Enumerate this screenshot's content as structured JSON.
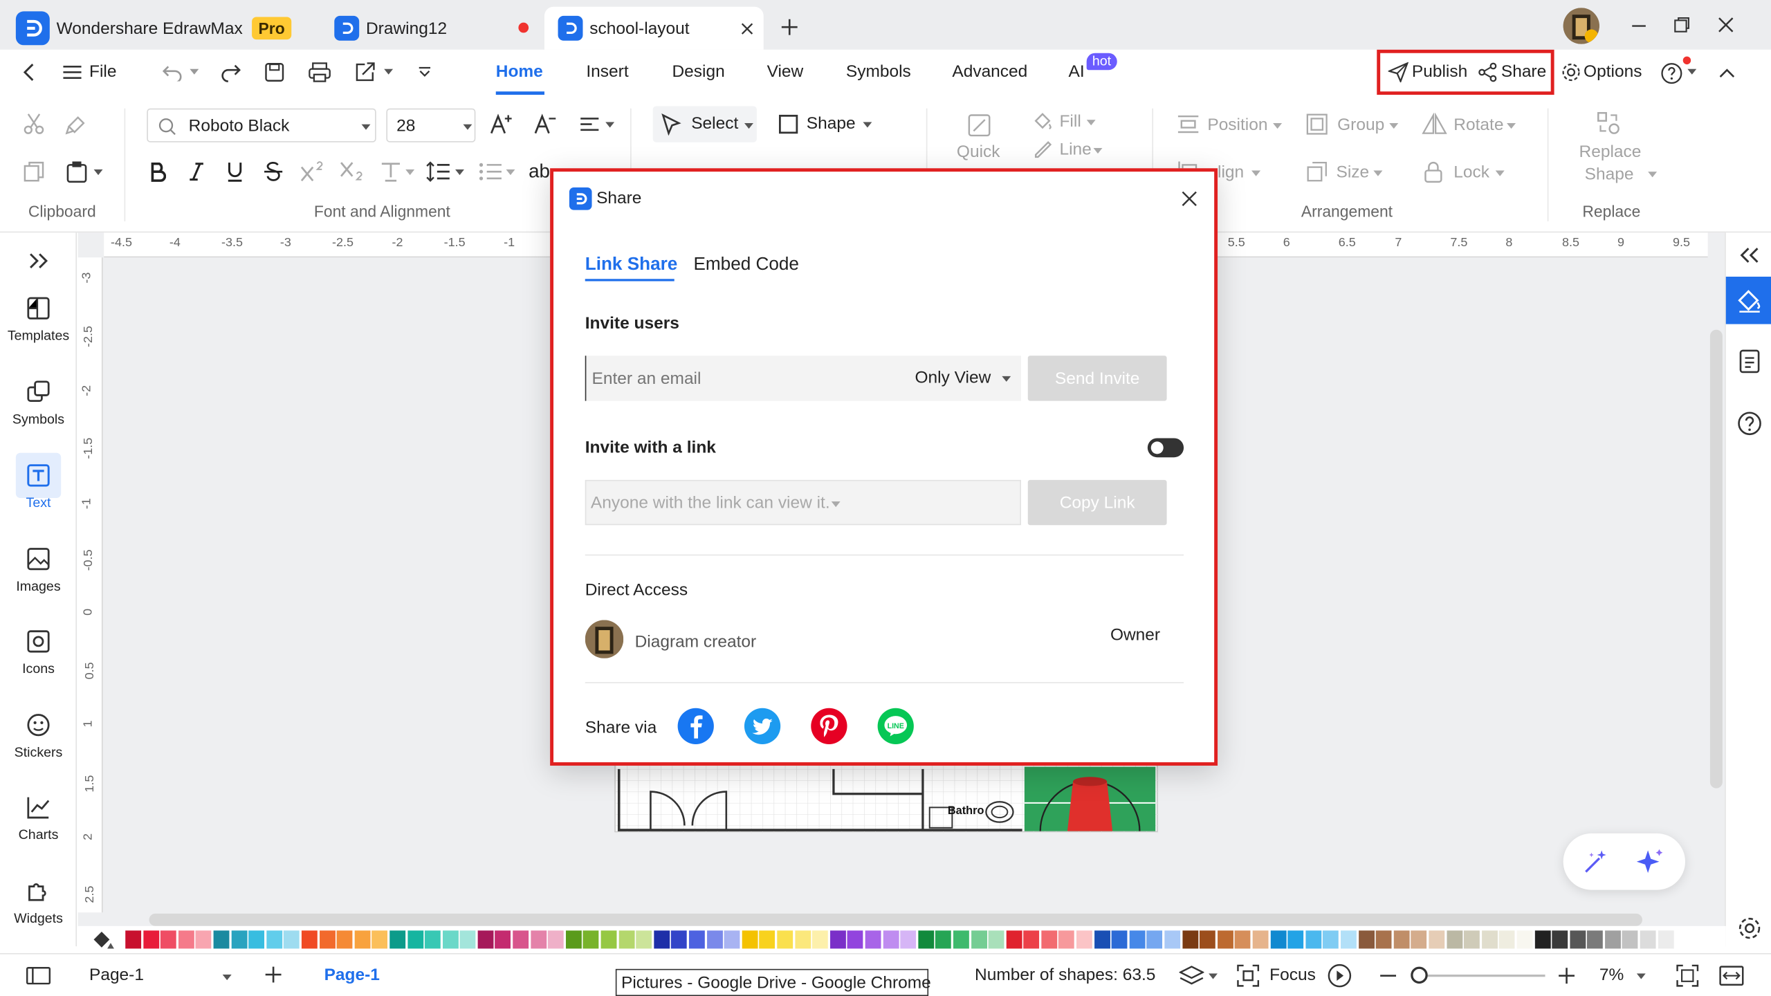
{
  "titlebar": {
    "app_name": "Wondershare EdrawMax",
    "pro_badge": "Pro",
    "tabs": [
      {
        "label": "Drawing12"
      },
      {
        "label": "school-layout"
      }
    ]
  },
  "menubar": {
    "file": "File",
    "items": [
      "Home",
      "Insert",
      "Design",
      "View",
      "Symbols",
      "Advanced",
      "AI"
    ],
    "ai_badge": "hot",
    "publish": "Publish",
    "share": "Share",
    "options": "Options"
  },
  "ribbon": {
    "font_name": "Roboto Black",
    "font_size": "28",
    "select": "Select",
    "shape": "Shape",
    "quick": "Quick",
    "fill": "Fill",
    "line": "Line",
    "position": "Position",
    "group": "Group",
    "rotate": "Rotate",
    "align_partial": "lign",
    "size": "Size",
    "lock": "Lock",
    "replace_shape_1": "Replace",
    "replace_shape_2": "Shape",
    "group_labels": {
      "clipboard": "Clipboard",
      "font": "Font and Alignment",
      "arrangement": "Arrangement",
      "replace": "Replace"
    }
  },
  "left_panel": [
    "Templates",
    "Symbols",
    "Text",
    "Images",
    "Icons",
    "Stickers",
    "Charts",
    "Widgets"
  ],
  "rulers": {
    "h_left": [
      "-4.5",
      "-4",
      "-3.5",
      "-3",
      "-2.5",
      "-2",
      "-1.5",
      "-1"
    ],
    "h_right": [
      "5.5",
      "6",
      "6.5",
      "7",
      "7.5",
      "8",
      "8.5",
      "9",
      "9.5"
    ],
    "v": [
      "-3",
      "-2.5",
      "-2",
      "-1.5",
      "-1",
      "-0.5",
      "0",
      "0.5",
      "1",
      "1.5",
      "2",
      "2.5"
    ]
  },
  "canvas": {
    "bathroom_label": "Bathro"
  },
  "dialog": {
    "title": "Share",
    "tabs": {
      "link_share": "Link Share",
      "embed_code": "Embed Code"
    },
    "invite_users": "Invite users",
    "email_placeholder": "Enter an email",
    "permission": "Only View",
    "send_invite": "Send Invite",
    "invite_with_link": "Invite with a link",
    "link_permission": "Anyone with the link can view it.",
    "copy_link": "Copy Link",
    "direct_access": "Direct Access",
    "creator_name": "Diagram creator",
    "creator_role": "Owner",
    "share_via": "Share via"
  },
  "statusbar": {
    "page_select": "Page-1",
    "page_tab": "Page-1",
    "tooltip": "Pictures - Google Drive - Google Chrome",
    "shape_count": "Number of shapes: 63.5",
    "focus": "Focus",
    "zoom": "7%"
  },
  "colors": {
    "accent": "#1f6feb",
    "highlight": "#e02020",
    "facebook": "#1877f2",
    "twitter": "#1d9bf0",
    "pinterest": "#e60023",
    "line": "#06c755"
  },
  "palette": [
    "#c8102e",
    "#e81c3a",
    "#ef4d64",
    "#f57a8a",
    "#f8a5b0",
    "#1b8aa0",
    "#2aa3bf",
    "#38bde0",
    "#61cdeb",
    "#9edcf0",
    "#f04a24",
    "#f26a2c",
    "#f58a35",
    "#f8a23e",
    "#fbbf5a",
    "#0c9b8a",
    "#16b5a0",
    "#38c8b4",
    "#6ad8c8",
    "#a3e5db",
    "#a6195a",
    "#c42b6f",
    "#d8558c",
    "#e482a9",
    "#efb0c8",
    "#5a9b1b",
    "#78b32b",
    "#96c843",
    "#b4d76c",
    "#cce49a",
    "#1e2fa8",
    "#3244c8",
    "#4e62e0",
    "#7a89ea",
    "#a8b3f2",
    "#f4c200",
    "#f8d21e",
    "#fae04e",
    "#fbe87c",
    "#fdf0ab",
    "#7a2fc8",
    "#9244de",
    "#a864e8",
    "#bf8cf0",
    "#d6b5f6",
    "#128a3c",
    "#26a554",
    "#3eba6d",
    "#74cd93",
    "#a9e0ba",
    "#e0222e",
    "#ec4048",
    "#f26b70",
    "#f7999c",
    "#fbc4c6",
    "#1a4fb4",
    "#2b6ad6",
    "#4688e8",
    "#75a7f0",
    "#a8c8f6",
    "#7a3a12",
    "#9c4e1c",
    "#bd6a30",
    "#d68e5a",
    "#e6b48c",
    "#1189d0",
    "#22a3e6",
    "#4bb8ee",
    "#7fccf3",
    "#b2e0f8",
    "#8a5a3c",
    "#a8724c",
    "#c08e68",
    "#d4ac8c",
    "#e6cdb6",
    "#bbb8a4",
    "#cfcbb8",
    "#e0ddcc",
    "#efede0",
    "#f8f7f0",
    "#222222",
    "#3a3a3a",
    "#575757",
    "#7a7a7a",
    "#a0a0a0",
    "#c2c2c2",
    "#dcdcdc",
    "#ececec"
  ]
}
